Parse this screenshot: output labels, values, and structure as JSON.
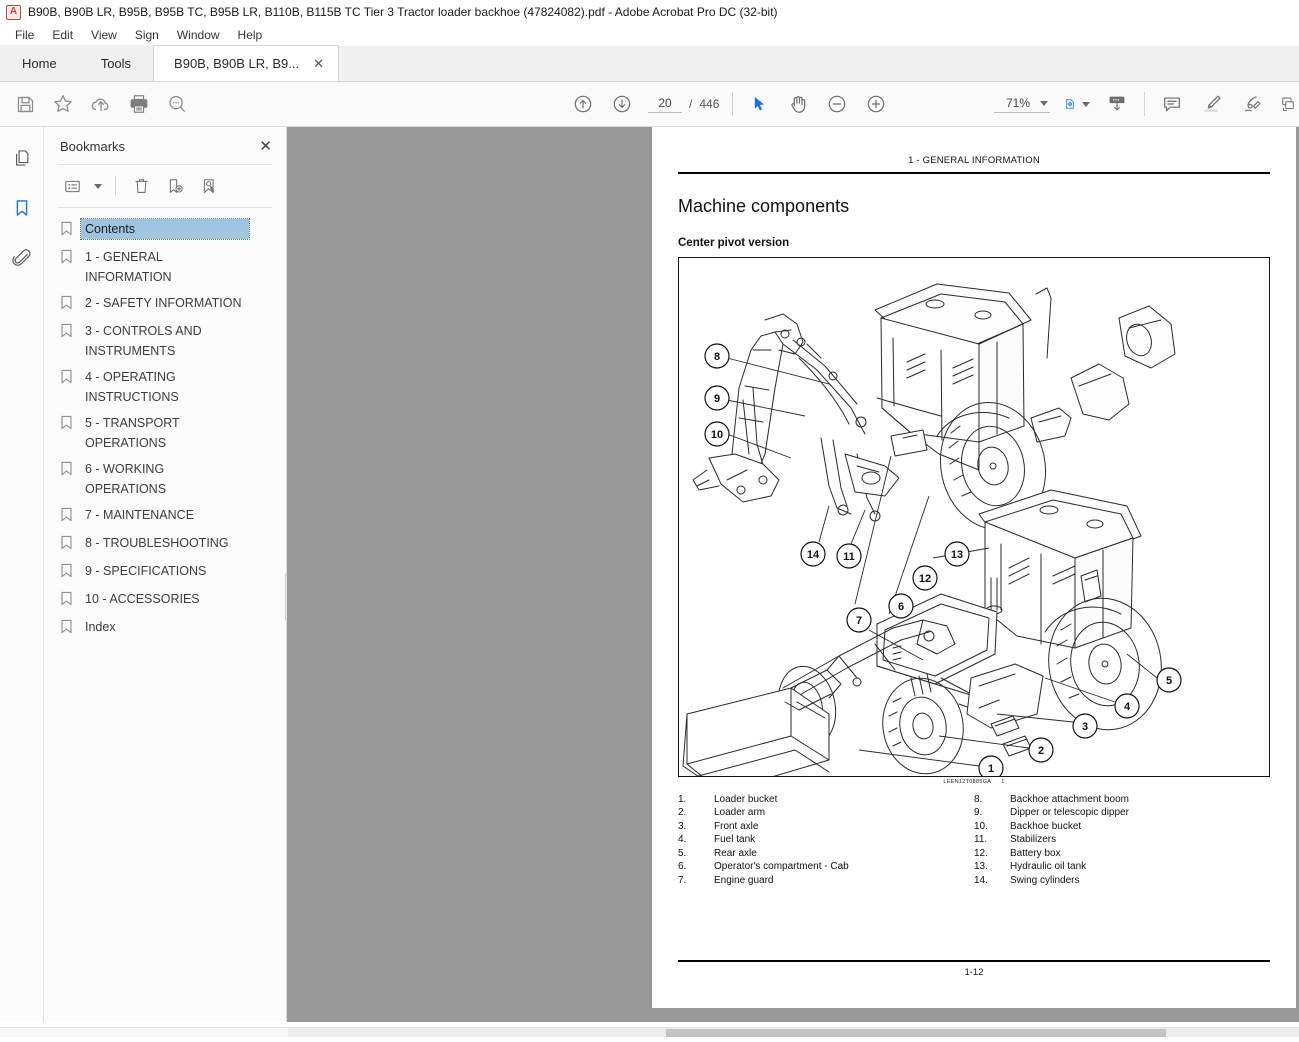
{
  "window": {
    "title": "B90B, B90B LR, B95B, B95B TC, B95B LR, B110B, B115B TC Tier 3 Tractor loader backhoe (47824082).pdf - Adobe Acrobat Pro DC (32-bit)",
    "app_icon": "acrobat-icon"
  },
  "menubar": {
    "items": [
      "File",
      "Edit",
      "View",
      "Sign",
      "Window",
      "Help"
    ]
  },
  "tabs": {
    "home": "Home",
    "tools": "Tools",
    "document": "B90B, B90B LR, B9...",
    "close_glyph": "✕"
  },
  "toolbar": {
    "left_icons": [
      "save-icon",
      "star-icon",
      "upload-cloud-icon",
      "print-icon",
      "search-icon"
    ],
    "prev_page": "previous-page-icon",
    "next_page": "next-page-icon",
    "page_current": "20",
    "page_separator": "/",
    "page_total": "446",
    "select_tool": "select-arrow-icon",
    "hand_tool": "hand-icon",
    "zoom_out": "zoom-out-icon",
    "zoom_in": "zoom-in-icon",
    "zoom_value": "71%",
    "fit_page": "fit-page-icon",
    "scroll_mode": "page-display-icon",
    "right_icons": [
      "comment-icon",
      "highlight-icon",
      "sign-icon",
      "stamp-icon"
    ]
  },
  "rail": {
    "items": [
      "page-thumbnails-icon",
      "bookmarks-icon",
      "attachments-icon"
    ],
    "active": "bookmarks-icon"
  },
  "bookmarks_panel": {
    "title": "Bookmarks",
    "close": "✕",
    "tools": [
      "options-menu-icon",
      "delete-bookmark-icon",
      "new-bookmark-icon",
      "find-bookmark-icon"
    ],
    "items": [
      {
        "label": "Contents",
        "selected": true
      },
      {
        "label": "1 - GENERAL INFORMATION",
        "selected": false
      },
      {
        "label": "2 - SAFETY INFORMATION",
        "selected": false
      },
      {
        "label": "3 - CONTROLS AND INSTRUMENTS",
        "selected": false
      },
      {
        "label": "4 - OPERATING INSTRUCTIONS",
        "selected": false
      },
      {
        "label": "5 - TRANSPORT OPERATIONS",
        "selected": false
      },
      {
        "label": "6 - WORKING OPERATIONS",
        "selected": false
      },
      {
        "label": "7 - MAINTENANCE",
        "selected": false
      },
      {
        "label": "8 - TROUBLESHOOTING",
        "selected": false
      },
      {
        "label": "9 - SPECIFICATIONS",
        "selected": false
      },
      {
        "label": "10 - ACCESSORIES",
        "selected": false
      },
      {
        "label": "Index",
        "selected": false
      }
    ]
  },
  "document": {
    "running_head": "1 - GENERAL INFORMATION",
    "heading": "Machine components",
    "subheading": "Center pivot version",
    "figure_code": "LEEN12T0885GA",
    "figure_number": "1",
    "legend_left": [
      {
        "num": "1.",
        "text": "Loader bucket"
      },
      {
        "num": "2.",
        "text": "Loader arm"
      },
      {
        "num": "3.",
        "text": "Front axle"
      },
      {
        "num": "4.",
        "text": "Fuel tank"
      },
      {
        "num": "5.",
        "text": "Rear axle"
      },
      {
        "num": "6.",
        "text": "Operator's compartment - Cab"
      },
      {
        "num": "7.",
        "text": "Engine guard"
      }
    ],
    "legend_right": [
      {
        "num": "8.",
        "text": "Backhoe attachment boom"
      },
      {
        "num": "9.",
        "text": "Dipper or telescopic dipper"
      },
      {
        "num": "10.",
        "text": "Backhoe bucket"
      },
      {
        "num": "11.",
        "text": "Stabilizers"
      },
      {
        "num": "12.",
        "text": "Battery box"
      },
      {
        "num": "13.",
        "text": "Hydraulic oil tank"
      },
      {
        "num": "14.",
        "text": "Swing cylinders"
      }
    ],
    "callouts": [
      "1",
      "2",
      "3",
      "4",
      "5",
      "6",
      "7",
      "8",
      "9",
      "10",
      "11",
      "12",
      "13",
      "14"
    ],
    "footer_page": "1-12"
  },
  "colors": {
    "accent": "#1473e6",
    "selection": "#9fc5e0",
    "viewport_bg": "#999999",
    "toolbar_bg": "#fafafa"
  }
}
